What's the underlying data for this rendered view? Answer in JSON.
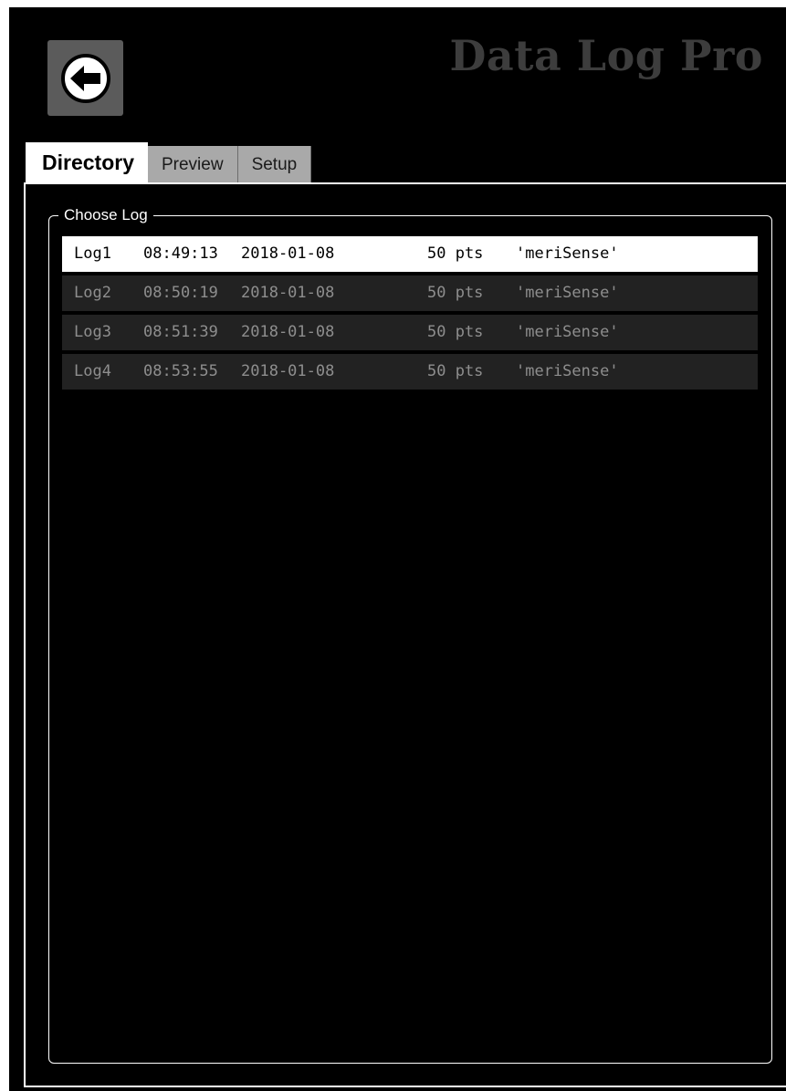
{
  "app": {
    "title": "Data Log Pro",
    "title_color": "#3d3d3d"
  },
  "header": {
    "back_icon": "arrow-left-circle-icon"
  },
  "tabs": [
    {
      "label": "Directory",
      "active": true
    },
    {
      "label": "Preview",
      "active": false
    },
    {
      "label": "Setup",
      "active": false
    }
  ],
  "groupbox": {
    "legend": "Choose Log"
  },
  "logs": [
    {
      "name": "Log1",
      "time": "08:49:13",
      "date": "2018-01-08",
      "points": "50 pts",
      "label": "'meriSense'",
      "selected": true
    },
    {
      "name": "Log2",
      "time": "08:50:19",
      "date": "2018-01-08",
      "points": "50 pts",
      "label": "'meriSense'",
      "selected": false
    },
    {
      "name": "Log3",
      "time": "08:51:39",
      "date": "2018-01-08",
      "points": "50 pts",
      "label": "'meriSense'",
      "selected": false
    },
    {
      "name": "Log4",
      "time": "08:53:55",
      "date": "2018-01-08",
      "points": "50 pts",
      "label": "'meriSense'",
      "selected": false
    }
  ],
  "colors": {
    "background": "#000000",
    "row_background": "#222222",
    "row_text": "#8e8e8e",
    "selected_row_background": "#ffffff",
    "selected_row_text": "#000000",
    "inactive_tab": "#a9a9a9"
  }
}
